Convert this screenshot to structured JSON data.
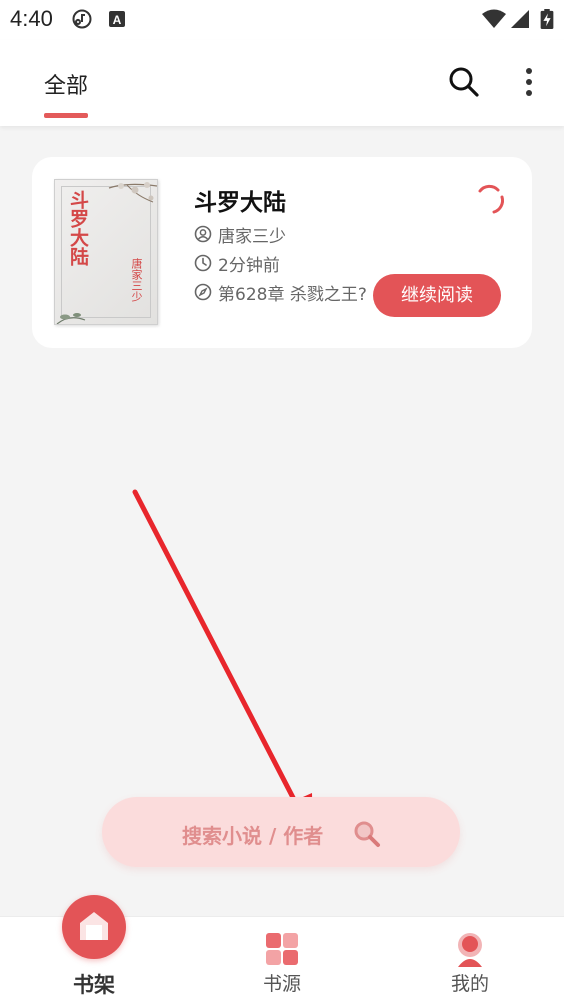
{
  "status_bar": {
    "time": "4:40",
    "icons": [
      "music-note-icon",
      "a-box-icon",
      "wifi-icon",
      "cellular-signal-icon",
      "battery-charging-icon"
    ]
  },
  "top_bar": {
    "tab_label": "全部",
    "search_icon": "search-icon",
    "more_icon": "more-vertical-icon",
    "accent_color": "#e35a5a"
  },
  "book": {
    "title": "斗罗大陆",
    "cover_title": "斗罗大陆",
    "cover_author": "唐家三少",
    "author": "唐家三少",
    "updated": "2分钟前",
    "chapter": "第628章 杀戮之王?",
    "continue_label": "继续阅读",
    "button_color": "#e35457"
  },
  "search_pill": {
    "placeholder": "搜索小说 / 作者",
    "icon": "magnifier-icon"
  },
  "bottom_nav": {
    "items": [
      {
        "label": "书架",
        "icon": "bookshelf-home-icon",
        "active": true
      },
      {
        "label": "书源",
        "icon": "grid-blocks-icon",
        "active": false
      },
      {
        "label": "我的",
        "icon": "person-icon",
        "active": false
      }
    ]
  }
}
